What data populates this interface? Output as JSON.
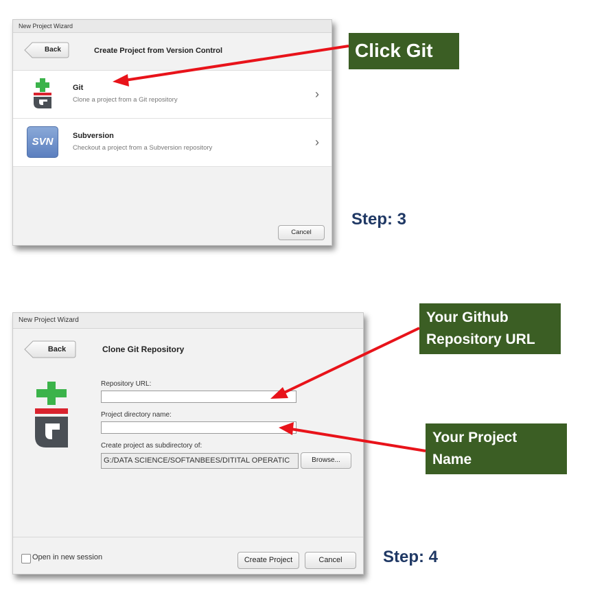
{
  "step3": {
    "window_title": "New Project Wizard",
    "back_label": "Back",
    "title": "Create Project from Version Control",
    "options": [
      {
        "name": "Git",
        "description": "Clone a project from a Git repository",
        "icon": "git-icon"
      },
      {
        "name": "Subversion",
        "description": "Checkout a project from a Subversion repository",
        "icon": "svn-icon",
        "icon_text": "SVN"
      }
    ],
    "cancel_label": "Cancel",
    "callout": "Click Git",
    "step_label": "Step: 3"
  },
  "step4": {
    "window_title": "New Project Wizard",
    "back_label": "Back",
    "title": "Clone Git Repository",
    "repo_url_label": "Repository URL:",
    "repo_url_value": "",
    "dir_name_label": "Project directory name:",
    "dir_name_value": "",
    "subdir_label": "Create project as subdirectory of:",
    "subdir_value": "G:/DATA SCIENCE/SOFTANBEES/DITITAL OPERATIC",
    "browse_label": "Browse...",
    "open_new_session_label": "Open in new session",
    "open_new_session_checked": false,
    "create_label": "Create Project",
    "cancel_label": "Cancel",
    "callout_repo": "Your Github Repository URL",
    "callout_repo_line1": "Your Github",
    "callout_repo_line2": "Repository URL",
    "callout_name_line1": "Your Project",
    "callout_name_line2": "Name",
    "step_label": "Step: 4"
  },
  "colors": {
    "callout_bg": "#3b5e24",
    "arrow": "#e8131a",
    "step_text": "#1f3864",
    "git_green": "#3bb34a",
    "git_red": "#d9232e",
    "git_gray": "#4a4f55",
    "svn_blue": "#6d8fc7"
  }
}
